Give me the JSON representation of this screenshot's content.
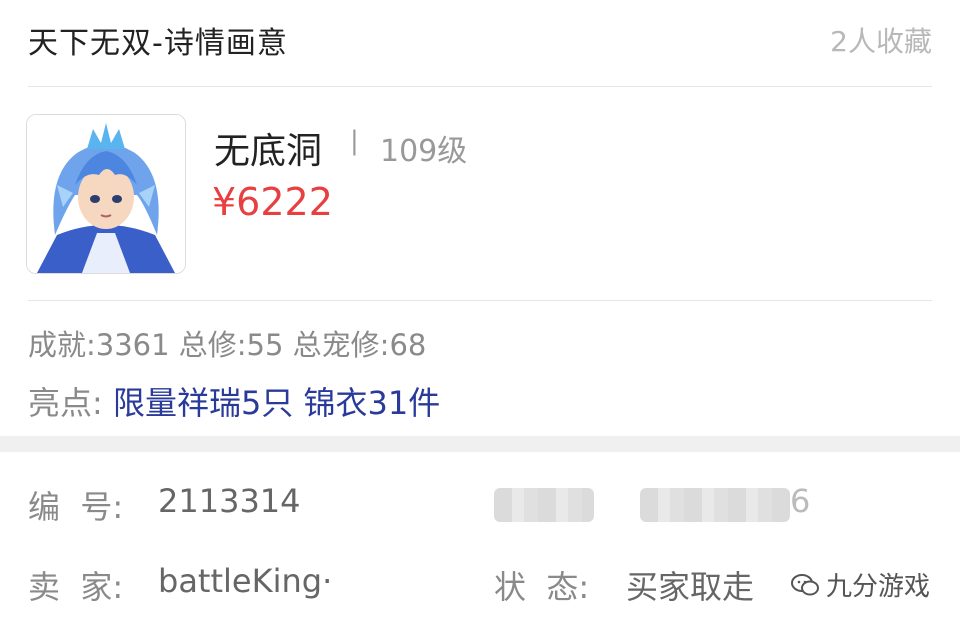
{
  "header": {
    "title": "天下无双-诗情画意",
    "favorites": "2人收藏"
  },
  "character": {
    "name": "无底洞",
    "separator": "|",
    "level": "109级",
    "price": "¥6222"
  },
  "stats": "成就:3361 总修:55 总宠修:68",
  "highlights": {
    "label": "亮点:",
    "value": "限量祥瑞5只 锦衣31件"
  },
  "details": {
    "id_label": "编  号:",
    "id_value": "2113314",
    "seller_label": "卖  家:",
    "seller_value": "battleKing·",
    "status_label": "状  态:",
    "status_value": "买家取走",
    "blurred_tail": "6"
  },
  "watermark": {
    "icon": "wechat-icon",
    "text": "九分游戏"
  }
}
